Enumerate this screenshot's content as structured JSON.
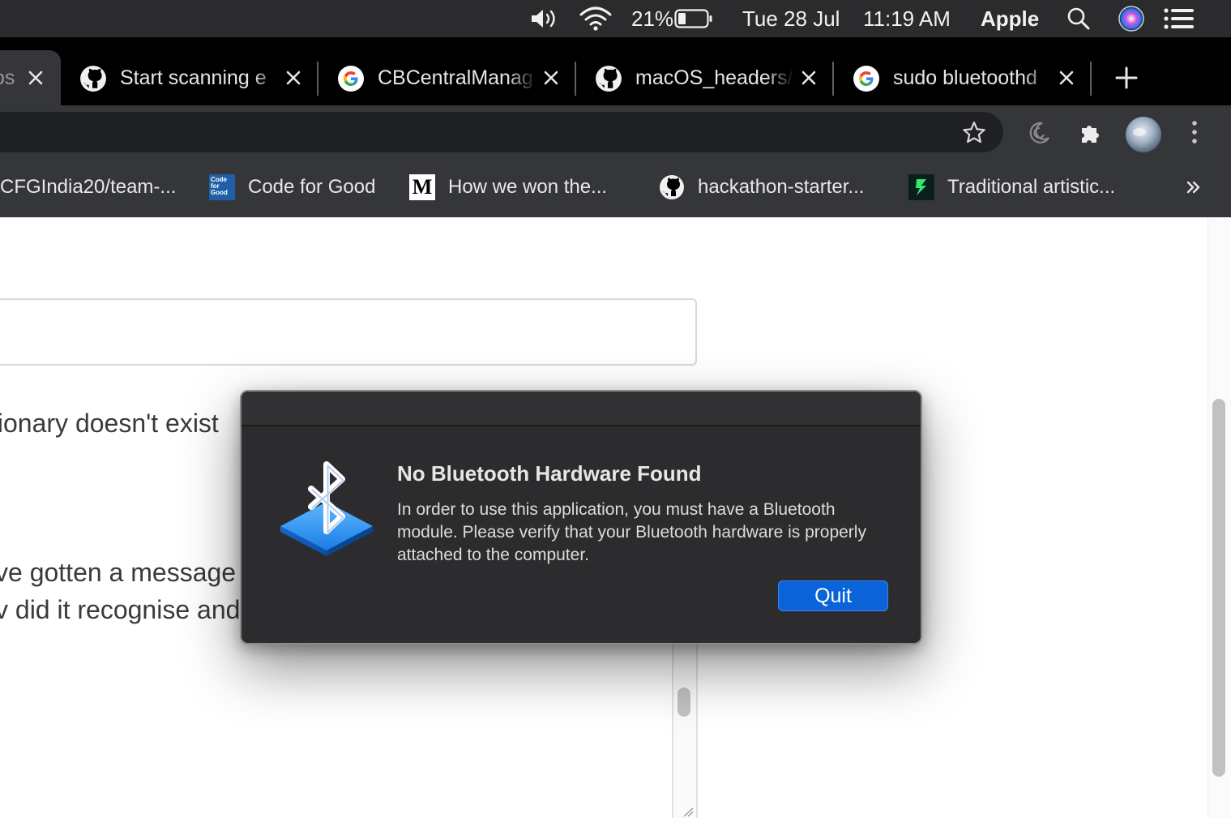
{
  "menubar": {
    "battery_percent": "21%",
    "date": "Tue 28 Jul",
    "time": "11:19 AM",
    "app_name": "Apple",
    "icons": [
      "volume-icon",
      "wifi-icon",
      "battery-icon",
      "search-icon",
      "siri-icon",
      "control-center-icon"
    ]
  },
  "tabs": [
    {
      "title": "os",
      "favicon": "none",
      "active": true
    },
    {
      "title": "Start scanning e",
      "favicon": "github-icon"
    },
    {
      "title": "CBCentralManag",
      "favicon": "google-icon"
    },
    {
      "title": "macOS_headers/",
      "favicon": "github-icon"
    },
    {
      "title": "sudo bluetoothd",
      "favicon": "google-icon"
    }
  ],
  "toolbar": {
    "icons": [
      "bookmark-star-icon",
      "moon-extension-icon",
      "extensions-puzzle-icon",
      "profile-avatar",
      "more-menu-icon"
    ]
  },
  "bookmarks": [
    {
      "label": "CFGIndia20/team-...",
      "favicon": "none"
    },
    {
      "label": "Code for Good",
      "favicon": "code-for-good-icon",
      "icon_text": [
        "Code",
        "for",
        "Good"
      ]
    },
    {
      "label": "How we won the...",
      "favicon": "medium-icon",
      "icon_text": "M"
    },
    {
      "label": "hackathon-starter...",
      "favicon": "github-icon"
    },
    {
      "label": "Traditional artistic...",
      "favicon": "devpost-icon"
    }
  ],
  "page": {
    "text_fragments": [
      "tionary doesn't exist",
      "ve gotten a message",
      "v did it recognise and"
    ]
  },
  "dialog": {
    "title": "No Bluetooth Hardware Found",
    "message": "In order to use this application, you must have a Bluetooth module. Please verify that your Bluetooth hardware is properly attached to the computer.",
    "button_label": "Quit",
    "icon": "bluetooth-icon"
  },
  "colors": {
    "menubar_bg": "#2b2b2d",
    "tabstrip_bg": "#000000",
    "toolbar_bg": "#35363a",
    "dialog_bg": "#2c2c2e",
    "accent_button": "#0a63d8"
  }
}
